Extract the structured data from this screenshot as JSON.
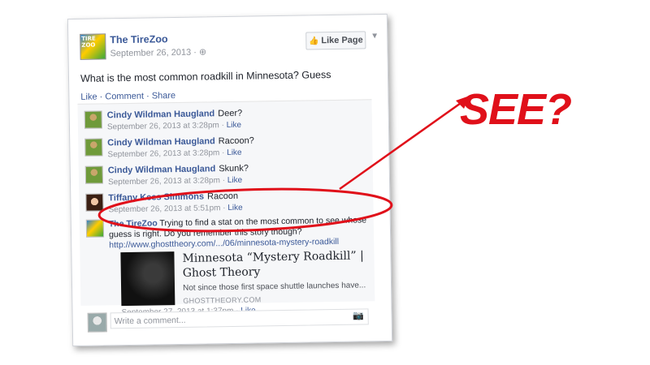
{
  "post": {
    "page_name": "The TireZoo",
    "avatar_text": "TIRE ZOO",
    "date": "September 26, 2013 ·",
    "like_page_label": "Like Page",
    "text": "What is the most common roadkill in Minnesota? Guess",
    "actions": "Like · Comment · Share"
  },
  "comments": [
    {
      "name": "Cindy Wildman Haugland",
      "text": "Deer?",
      "time": "September 26, 2013 at 3:28pm ·",
      "like": "Like"
    },
    {
      "name": "Cindy Wildman Haugland",
      "text": "Racoon?",
      "time": "September 26, 2013 at 3:28pm ·",
      "like": "Like"
    },
    {
      "name": "Cindy Wildman Haugland",
      "text": "Skunk?",
      "time": "September 26, 2013 at 3:28pm ·",
      "like": "Like"
    },
    {
      "name": "Tiffany Kees Simmons",
      "text": "Racoon",
      "time": "September 26, 2013 at 5:51pm ·",
      "like": "Like"
    }
  ],
  "reply": {
    "name": "The TireZoo",
    "text": "Trying to find a stat on the most common to see whose guess is right. Do you remember this story though?",
    "link": "http://www.ghosttheory.com/.../06/minnesota-mystery-roadkill"
  },
  "preview": {
    "title": "Minnesota “Mystery Roadkill” | Ghost Theory",
    "description": "Not since those first space shuttle launches have...",
    "domain": "GHOSTTHEORY.COM",
    "time": "September 27, 2013 at 1:37pm ·",
    "like": "Like"
  },
  "write_comment": {
    "placeholder": "Write a comment..."
  },
  "annotation": {
    "text": "SEE?",
    "color": "#e0101a"
  }
}
